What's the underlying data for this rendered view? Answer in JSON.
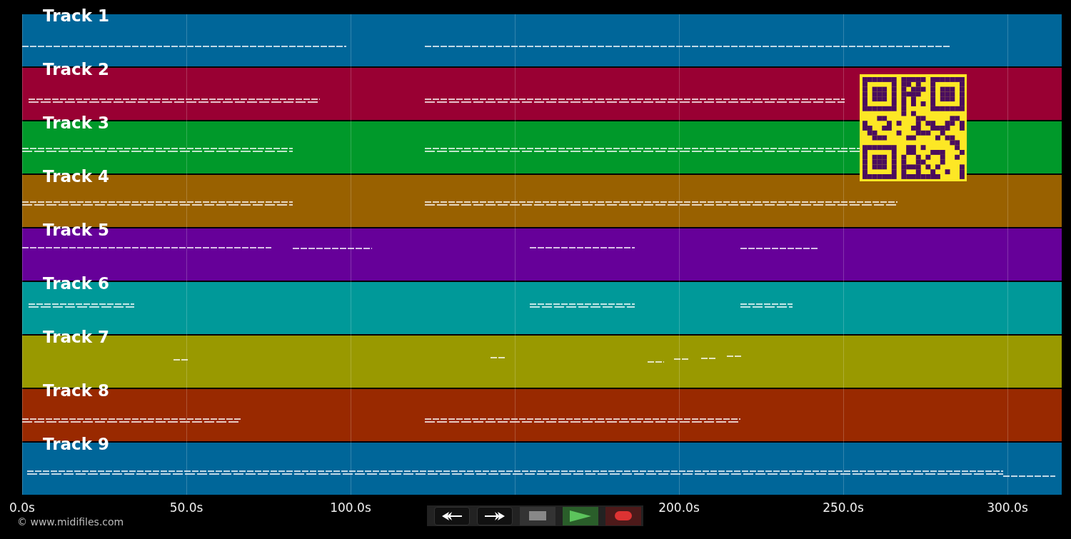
{
  "tracks": [
    {
      "label": "Track 1",
      "color": "#006699"
    },
    {
      "label": "Track 2",
      "color": "#990033"
    },
    {
      "label": "Track 3",
      "color": "#00992a"
    },
    {
      "label": "Track 4",
      "color": "#996100"
    },
    {
      "label": "Track 5",
      "color": "#660099"
    },
    {
      "label": "Track 6",
      "color": "#009999"
    },
    {
      "label": "Track 7",
      "color": "#999900"
    },
    {
      "label": "Track 8",
      "color": "#992900"
    },
    {
      "label": "Track 9",
      "color": "#006699"
    }
  ],
  "time_axis": {
    "ticks": [
      "0.0s",
      "50.0s",
      "100.0s",
      "200.0s",
      "250.0s",
      "300.0s"
    ]
  },
  "transport": [
    {
      "kind": "rewind"
    },
    {
      "kind": "forward"
    },
    {
      "kind": "stop"
    },
    {
      "kind": "play"
    },
    {
      "kind": "record"
    }
  ],
  "copyright": "© www.midifiles.com"
}
